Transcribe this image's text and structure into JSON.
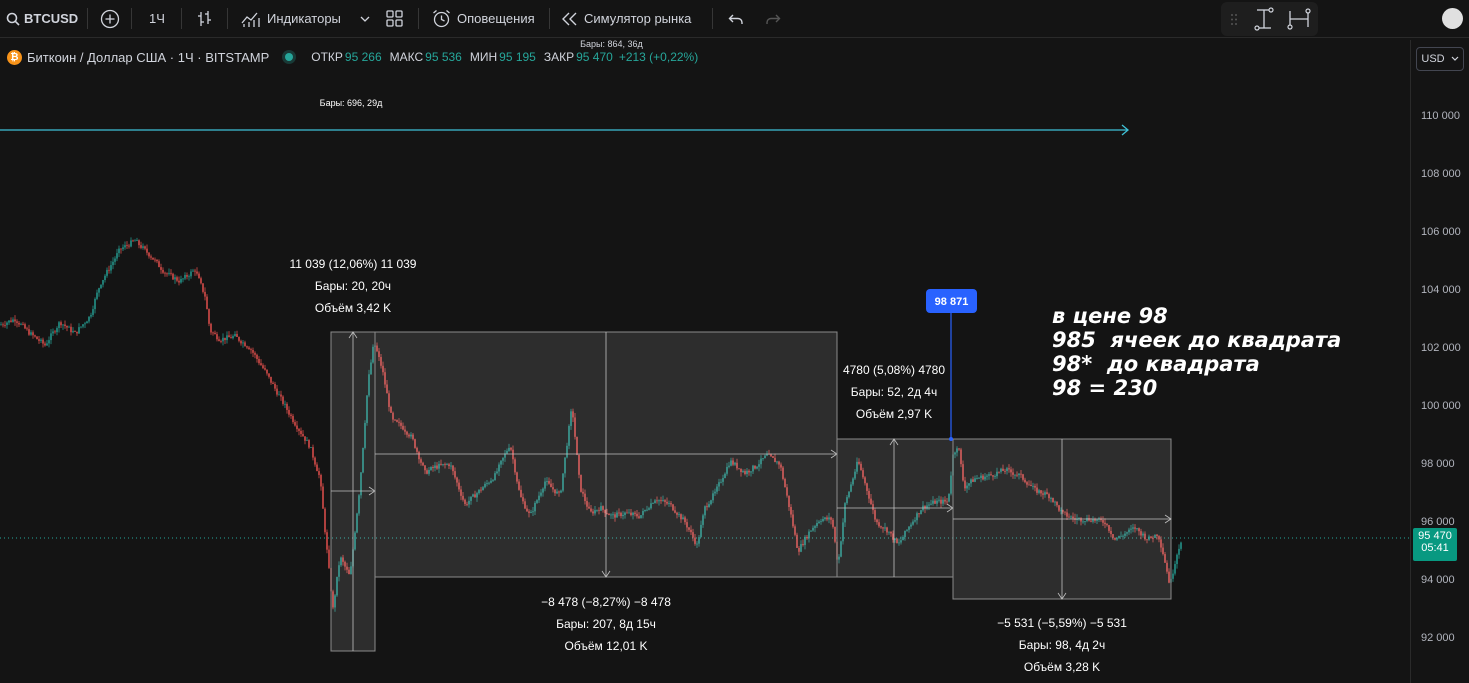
{
  "toolbar": {
    "symbol": "BTCUSD",
    "interval": "1Ч",
    "indicators": "Индикаторы",
    "alerts": "Оповещения",
    "replay": "Симулятор рынка"
  },
  "legend": {
    "title": "Биткоин / Доллар США · 1Ч · BITSTAMP",
    "open_label": "ОТКР",
    "open": "95 266",
    "high_label": "МАКС",
    "high": "95 536",
    "low_label": "МИН",
    "low": "95 195",
    "close_label": "ЗАКР",
    "close": "95 470",
    "change": "+213 (+0,22%)",
    "bars_overlay": "Бары: 864, 36д",
    "currency": "USD"
  },
  "price_axis": {
    "ticks": [
      "110 000",
      "108 000",
      "106 000",
      "104 000",
      "102 000",
      "100 000",
      "98 000",
      "96 000",
      "94 000",
      "92 000"
    ],
    "current_price": "95 470",
    "countdown": "05:41"
  },
  "drawings": {
    "top_range_label": "Бары: 696, 29д",
    "m1": {
      "l1": "11 039 (12,06%) 11 039",
      "l2": "Бары: 20, 20ч",
      "l3": "Объём 3,42 K"
    },
    "m2": {
      "l1": "−8 478 (−8,27%) −8 478",
      "l2": "Бары: 207, 8д 15ч",
      "l3": "Объём 12,01 K"
    },
    "m3": {
      "l1": "4780 (5,08%) 4780",
      "l2": "Бары: 52, 2д 4ч",
      "l3": "Объём 2,97 K"
    },
    "m4": {
      "l1": "−5 531 (−5,59%) −5 531",
      "l2": "Бары: 98, 4д 2ч",
      "l3": "Объём 3,28 K"
    },
    "price_marker": "98 871"
  },
  "note": {
    "line1": "в цене 98",
    "line2": "985  ячеек до квадрата",
    "line3": "98*  до квадрата",
    "line4": "98 = 230"
  },
  "colors": {
    "up": "#26a69a",
    "down": "#ef5350",
    "accent": "#2962ff",
    "range": "#3fc1d6"
  },
  "chart_data": {
    "type": "candlestick",
    "y_axis_ticks": [
      110000,
      108000,
      106000,
      104000,
      102000,
      100000,
      98000,
      96000,
      94000,
      92000
    ],
    "close_path": [
      [
        0,
        102800
      ],
      [
        15,
        103000
      ],
      [
        30,
        102500
      ],
      [
        45,
        102100
      ],
      [
        60,
        102900
      ],
      [
        75,
        102500
      ],
      [
        90,
        103100
      ],
      [
        100,
        104200
      ],
      [
        110,
        104800
      ],
      [
        120,
        105400
      ],
      [
        135,
        105700
      ],
      [
        150,
        105200
      ],
      [
        165,
        104600
      ],
      [
        180,
        104300
      ],
      [
        195,
        104700
      ],
      [
        205,
        103800
      ],
      [
        210,
        102600
      ],
      [
        220,
        102300
      ],
      [
        235,
        102400
      ],
      [
        250,
        102000
      ],
      [
        265,
        101200
      ],
      [
        280,
        100300
      ],
      [
        295,
        99400
      ],
      [
        310,
        98600
      ],
      [
        320,
        97500
      ],
      [
        327,
        95000
      ],
      [
        333,
        93000
      ],
      [
        340,
        94800
      ],
      [
        350,
        94100
      ],
      [
        360,
        97300
      ],
      [
        368,
        100800
      ],
      [
        374,
        102200
      ],
      [
        382,
        101300
      ],
      [
        392,
        99500
      ],
      [
        402,
        99300
      ],
      [
        412,
        98900
      ],
      [
        425,
        97700
      ],
      [
        435,
        97900
      ],
      [
        450,
        98000
      ],
      [
        465,
        96600
      ],
      [
        480,
        97100
      ],
      [
        495,
        97600
      ],
      [
        510,
        98700
      ],
      [
        520,
        96900
      ],
      [
        530,
        96200
      ],
      [
        545,
        97400
      ],
      [
        560,
        96900
      ],
      [
        572,
        100000
      ],
      [
        580,
        97200
      ],
      [
        590,
        96300
      ],
      [
        600,
        96500
      ],
      [
        612,
        96200
      ],
      [
        625,
        96300
      ],
      [
        640,
        96200
      ],
      [
        655,
        96800
      ],
      [
        670,
        96600
      ],
      [
        685,
        96000
      ],
      [
        697,
        95200
      ],
      [
        705,
        96500
      ],
      [
        715,
        97000
      ],
      [
        730,
        98100
      ],
      [
        745,
        97700
      ],
      [
        755,
        97900
      ],
      [
        767,
        98300
      ],
      [
        780,
        98000
      ],
      [
        790,
        96400
      ],
      [
        798,
        95000
      ],
      [
        810,
        95700
      ],
      [
        820,
        96100
      ],
      [
        832,
        96100
      ],
      [
        838,
        94500
      ],
      [
        845,
        96600
      ],
      [
        858,
        98100
      ],
      [
        868,
        97000
      ],
      [
        876,
        96000
      ],
      [
        888,
        95700
      ],
      [
        898,
        95200
      ],
      [
        910,
        95900
      ],
      [
        922,
        96500
      ],
      [
        936,
        96700
      ],
      [
        948,
        96700
      ],
      [
        953,
        98300
      ],
      [
        958,
        98700
      ],
      [
        964,
        97200
      ],
      [
        975,
        97500
      ],
      [
        990,
        97600
      ],
      [
        1005,
        97800
      ],
      [
        1020,
        97600
      ],
      [
        1035,
        97100
      ],
      [
        1050,
        96900
      ],
      [
        1062,
        96300
      ],
      [
        1075,
        96100
      ],
      [
        1090,
        96100
      ],
      [
        1105,
        96000
      ],
      [
        1115,
        95400
      ],
      [
        1125,
        95600
      ],
      [
        1135,
        95800
      ],
      [
        1148,
        95400
      ],
      [
        1158,
        95600
      ],
      [
        1164,
        94800
      ],
      [
        1170,
        93800
      ],
      [
        1176,
        94800
      ],
      [
        1182,
        95470
      ]
    ],
    "measures": [
      {
        "change": 11039,
        "percent": 12.06,
        "bars": 20,
        "duration": "20ч",
        "volume": "3,42 K"
      },
      {
        "change": -8478,
        "percent": -8.27,
        "bars": 207,
        "duration": "8д 15ч",
        "volume": "12,01 K"
      },
      {
        "change": 4780,
        "percent": 5.08,
        "bars": 52,
        "duration": "2д 4ч",
        "volume": "2,97 K"
      },
      {
        "change": -5531,
        "percent": -5.59,
        "bars": 98,
        "duration": "4д 2ч",
        "volume": "3,28 K"
      }
    ],
    "marked_price": 98871,
    "last_price": 95470
  }
}
